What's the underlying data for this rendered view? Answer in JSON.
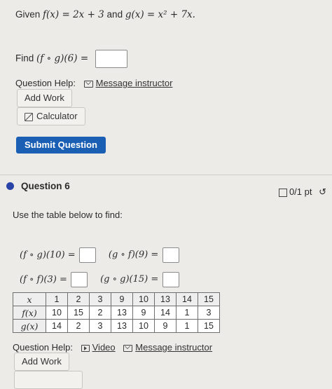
{
  "q5": {
    "given_prefix": "Given",
    "given_f": "f(x) = 2x + 3",
    "given_and": "and",
    "given_g": "g(x) = x² + 7x.",
    "find_label": "Find",
    "find_expr": "(f ∘ g)(6) =",
    "help_label": "Question Help:",
    "message_link": "Message instructor",
    "add_work": "Add Work",
    "calculator": "Calculator",
    "submit": "Submit Question"
  },
  "q6": {
    "title": "Question 6",
    "points": "0/1 pt",
    "instructions": "Use the table below to find:",
    "expr1": "(f ∘ g)(10) =",
    "expr2": "(g ∘ f)(9) =",
    "expr3": "(f ∘ f)(3) =",
    "expr4": "(g ∘ g)(15) =",
    "table": {
      "header": [
        "x",
        "1",
        "2",
        "3",
        "9",
        "10",
        "13",
        "14",
        "15"
      ],
      "f_label": "f(x)",
      "f_row": [
        "10",
        "15",
        "2",
        "13",
        "9",
        "14",
        "1",
        "3"
      ],
      "g_label": "g(x)",
      "g_row": [
        "14",
        "2",
        "3",
        "13",
        "10",
        "9",
        "1",
        "15"
      ]
    },
    "help_label": "Question Help:",
    "video_link": "Video",
    "message_link": "Message instructor",
    "add_work": "Add Work"
  },
  "icons": {
    "message": "envelope-icon",
    "video": "video-icon",
    "calculator": "calculator-icon",
    "points": "checkbox-icon",
    "retry": "retry-icon"
  },
  "colors": {
    "submit_bg": "#1a5fb4",
    "question_dot": "#2a43a6"
  }
}
